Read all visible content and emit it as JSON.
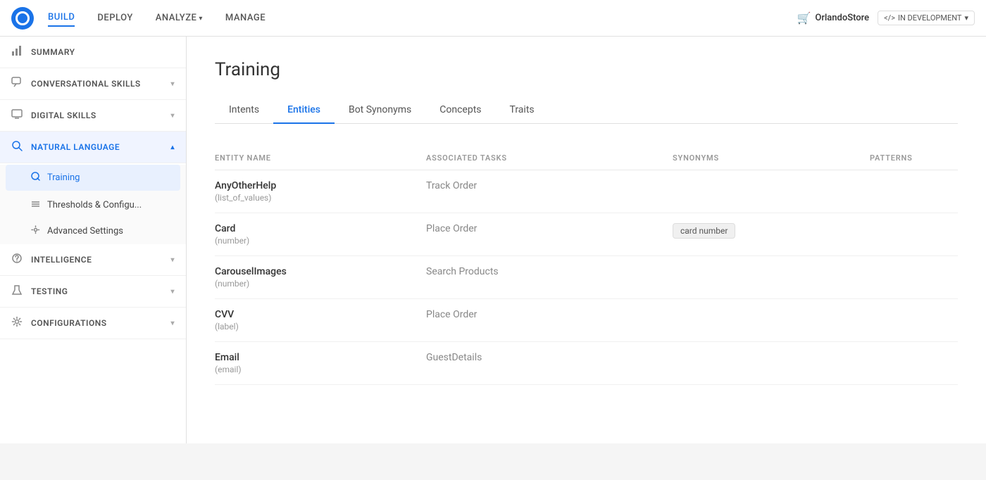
{
  "nav": {
    "items": [
      {
        "label": "BUILD",
        "active": true,
        "hasArrow": false
      },
      {
        "label": "DEPLOY",
        "active": false,
        "hasArrow": false
      },
      {
        "label": "ANALYZE",
        "active": false,
        "hasArrow": true
      },
      {
        "label": "MANAGE",
        "active": false,
        "hasArrow": false
      }
    ],
    "store": "OrlandoStore",
    "devBadge": "IN DEVELOPMENT"
  },
  "sidebar": {
    "items": [
      {
        "label": "SUMMARY",
        "icon": "📊",
        "hasArrow": false,
        "active": false
      },
      {
        "label": "CONVERSATIONAL SKILLS",
        "icon": "💬",
        "hasArrow": true,
        "active": false
      },
      {
        "label": "DIGITAL SKILLS",
        "icon": "🖥",
        "hasArrow": true,
        "active": false
      },
      {
        "label": "NATURAL LANGUAGE",
        "icon": "🔍",
        "hasArrow": true,
        "active": true,
        "subItems": [
          {
            "label": "Training",
            "icon": "🔍",
            "active": true
          },
          {
            "label": "Thresholds & Configu...",
            "icon": "≡",
            "active": false
          },
          {
            "label": "Advanced Settings",
            "icon": "⚙",
            "active": false
          }
        ]
      },
      {
        "label": "INTELLIGENCE",
        "icon": "🧠",
        "hasArrow": true,
        "active": false
      },
      {
        "label": "TESTING",
        "icon": "🔬",
        "hasArrow": true,
        "active": false
      },
      {
        "label": "CONFIGURATIONS",
        "icon": "⚙",
        "hasArrow": true,
        "active": false
      }
    ]
  },
  "main": {
    "title": "Training",
    "tabs": [
      {
        "label": "Intents",
        "active": false
      },
      {
        "label": "Entities",
        "active": true
      },
      {
        "label": "Bot Synonyms",
        "active": false
      },
      {
        "label": "Concepts",
        "active": false
      },
      {
        "label": "Traits",
        "active": false
      }
    ],
    "table": {
      "headers": [
        "ENTITY NAME",
        "ASSOCIATED TASKS",
        "SYNONYMS",
        "PATTERNS"
      ],
      "rows": [
        {
          "name": "AnyOtherHelp",
          "type": "(list_of_values)",
          "task": "Track Order",
          "synonyms": [],
          "patterns": []
        },
        {
          "name": "Card",
          "type": "(number)",
          "task": "Place Order",
          "synonyms": [
            "card number"
          ],
          "patterns": []
        },
        {
          "name": "CarouselImages",
          "type": "(number)",
          "task": "Search Products",
          "synonyms": [],
          "patterns": []
        },
        {
          "name": "CVV",
          "type": "(label)",
          "task": "Place Order",
          "synonyms": [],
          "patterns": []
        },
        {
          "name": "Email",
          "type": "(email)",
          "task": "GuestDetails",
          "synonyms": [],
          "patterns": []
        }
      ]
    }
  }
}
